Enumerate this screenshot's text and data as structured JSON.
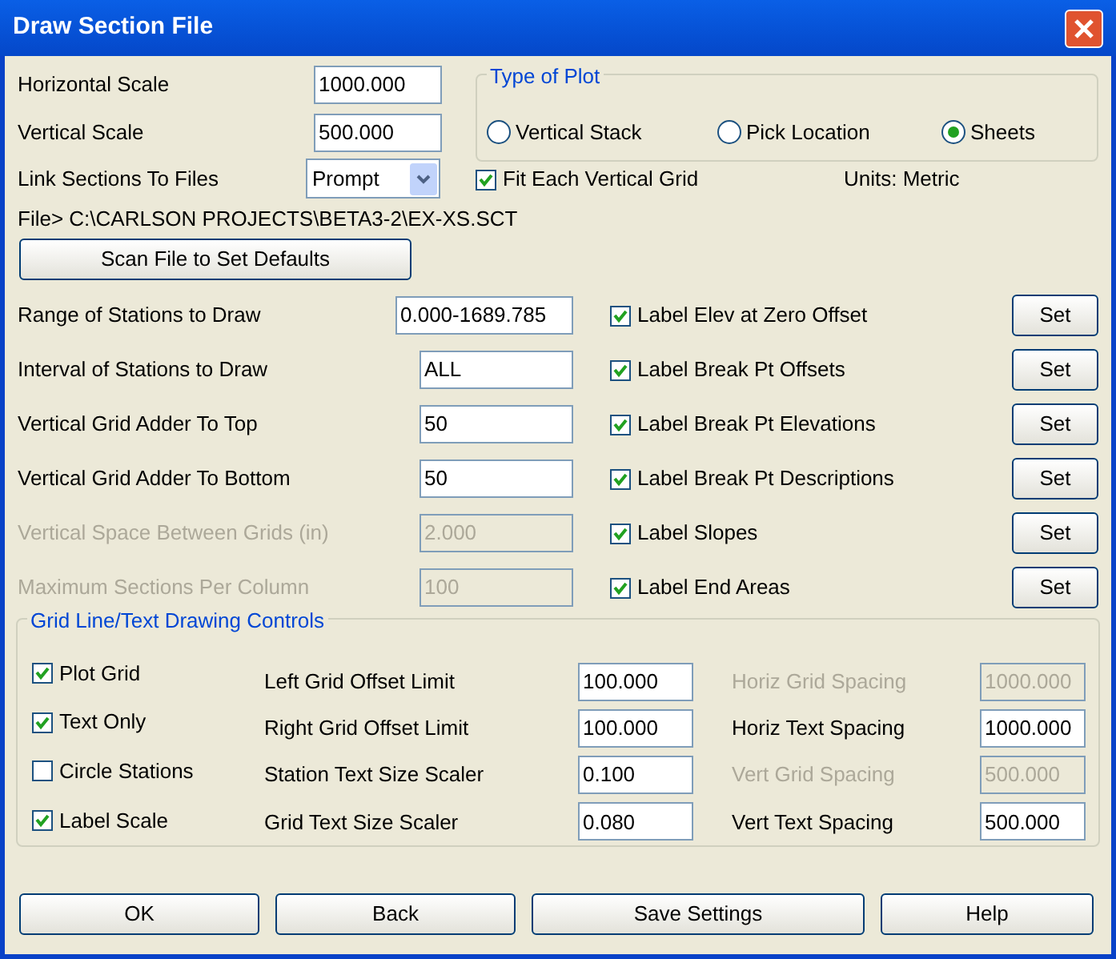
{
  "window": {
    "title": "Draw Section File"
  },
  "scales": [
    {
      "label": "Horizontal Scale",
      "value": "1000.000"
    },
    {
      "label": "Vertical Scale",
      "value": "500.000"
    }
  ],
  "link_sections": {
    "label": "Link Sections To Files",
    "value": "Prompt"
  },
  "type_of_plot": {
    "title": "Type of Plot",
    "options": [
      {
        "label": "Vertical Stack",
        "selected": false
      },
      {
        "label": "Pick Location",
        "selected": false
      },
      {
        "label": "Sheets",
        "selected": true
      }
    ]
  },
  "fit_each_vertical_grid": {
    "label": "Fit Each Vertical Grid",
    "checked": true
  },
  "units": "Units: Metric",
  "file": "File> C:\\CARLSON PROJECTS\\BETA3-2\\EX-XS.SCT",
  "scan_button": "Scan File to Set Defaults",
  "station_rows": [
    {
      "label": "Range of Stations to Draw",
      "value": "0.000-1689.785",
      "disabled": false
    },
    {
      "label": "Interval of Stations to Draw",
      "value": "ALL",
      "disabled": false
    },
    {
      "label": "Vertical Grid Adder To Top",
      "value": "50",
      "disabled": false
    },
    {
      "label": "Vertical Grid Adder To Bottom",
      "value": "50",
      "disabled": false
    },
    {
      "label": "Vertical Space Between Grids (in)",
      "value": "2.000",
      "disabled": true
    },
    {
      "label": "Maximum Sections Per Column",
      "value": "100",
      "disabled": true
    }
  ],
  "label_options": [
    {
      "label": "Label Elev at Zero Offset",
      "checked": true,
      "button": "Set"
    },
    {
      "label": "Label Break Pt Offsets",
      "checked": true,
      "button": "Set"
    },
    {
      "label": "Label Break Pt Elevations",
      "checked": true,
      "button": "Set"
    },
    {
      "label": "Label Break Pt Descriptions",
      "checked": true,
      "button": "Set"
    },
    {
      "label": "Label Slopes",
      "checked": true,
      "button": "Set"
    },
    {
      "label": "Label End Areas",
      "checked": true,
      "button": "Set"
    }
  ],
  "grid_controls": {
    "title": "Grid Line/Text Drawing Controls",
    "toggles": [
      {
        "label": "Plot Grid",
        "checked": true
      },
      {
        "label": "Text Only",
        "checked": true
      },
      {
        "label": "Circle Stations",
        "checked": false
      },
      {
        "label": "Label Scale",
        "checked": true
      }
    ],
    "fields": [
      {
        "label": "Left Grid Offset Limit",
        "value": "100.000"
      },
      {
        "label": "Right Grid Offset Limit",
        "value": "100.000"
      },
      {
        "label": "Station Text Size Scaler",
        "value": "0.100"
      },
      {
        "label": "Grid Text Size Scaler",
        "value": "0.080"
      }
    ],
    "spacing": [
      {
        "label": "Horiz Grid Spacing",
        "value": "1000.000",
        "disabled": true
      },
      {
        "label": "Horiz Text Spacing",
        "value": "1000.000",
        "disabled": false
      },
      {
        "label": "Vert Grid Spacing",
        "value": "500.000",
        "disabled": true
      },
      {
        "label": "Vert Text Spacing",
        "value": "500.000",
        "disabled": false
      }
    ]
  },
  "buttons": [
    "OK",
    "Back",
    "Save Settings",
    "Help"
  ]
}
